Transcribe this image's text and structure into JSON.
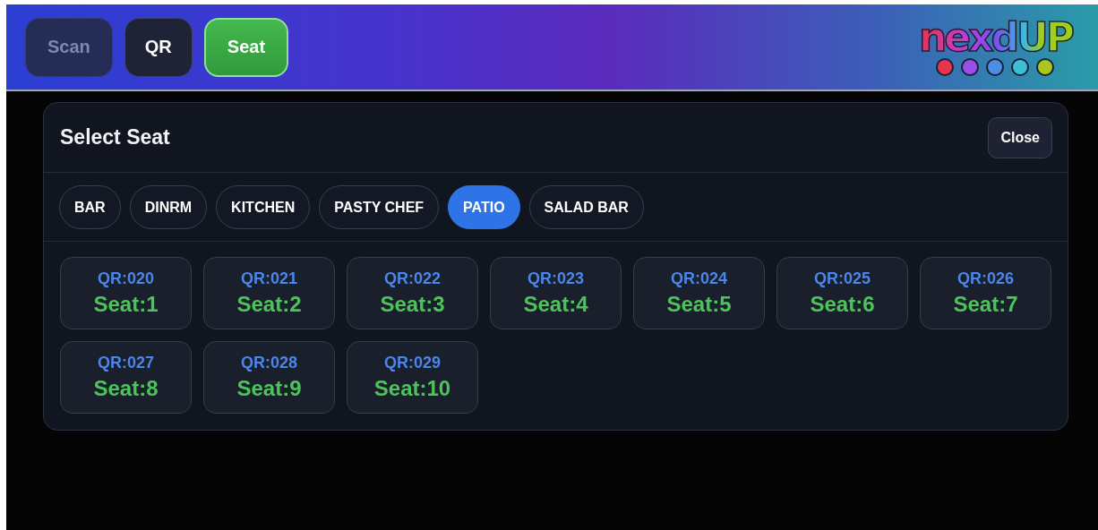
{
  "header": {
    "buttons": [
      {
        "label": "Scan",
        "selected": false,
        "disabled": true
      },
      {
        "label": "QR",
        "selected": false,
        "disabled": false
      },
      {
        "label": "Seat",
        "selected": true,
        "disabled": false
      }
    ],
    "logo": {
      "text": "nexdUP"
    }
  },
  "dialog": {
    "title": "Select Seat",
    "close": "Close",
    "areas": [
      {
        "label": "BAR",
        "selected": false
      },
      {
        "label": "DINRM",
        "selected": false
      },
      {
        "label": "KITCHEN",
        "selected": false
      },
      {
        "label": "PASTY CHEF",
        "selected": false
      },
      {
        "label": "PATIO",
        "selected": true
      },
      {
        "label": "SALAD BAR",
        "selected": false
      }
    ],
    "seats": [
      {
        "qr": "QR:020",
        "seat": "Seat:1"
      },
      {
        "qr": "QR:021",
        "seat": "Seat:2"
      },
      {
        "qr": "QR:022",
        "seat": "Seat:3"
      },
      {
        "qr": "QR:023",
        "seat": "Seat:4"
      },
      {
        "qr": "QR:024",
        "seat": "Seat:5"
      },
      {
        "qr": "QR:025",
        "seat": "Seat:6"
      },
      {
        "qr": "QR:026",
        "seat": "Seat:7"
      },
      {
        "qr": "QR:027",
        "seat": "Seat:8"
      },
      {
        "qr": "QR:028",
        "seat": "Seat:9"
      },
      {
        "qr": "QR:029",
        "seat": "Seat:10"
      }
    ]
  }
}
